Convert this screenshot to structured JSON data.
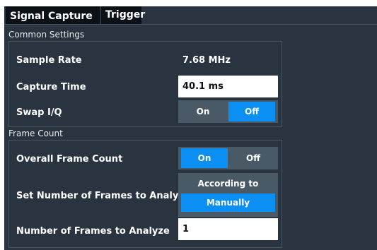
{
  "tabs": [
    {
      "label": "Signal Capture",
      "active": true
    },
    {
      "label": "Trigger",
      "active": false
    }
  ],
  "common_settings": {
    "title": "Common Settings",
    "sample_rate": {
      "label": "Sample Rate",
      "value": "7.68 MHz"
    },
    "capture_time": {
      "label": "Capture Time",
      "value": "40.1 ms"
    },
    "swap_iq": {
      "label": "Swap I/Q",
      "on": "On",
      "off": "Off",
      "selected": "Off"
    }
  },
  "frame_count": {
    "title": "Frame Count",
    "overall": {
      "label": "Overall Frame Count",
      "on": "On",
      "off": "Off",
      "selected": "On"
    },
    "set_number": {
      "label": "Set Number of Frames to Analyze",
      "option_standard": "According to Standard",
      "option_manual": "Manually",
      "selected": "Manually"
    },
    "number": {
      "label": "Number of Frames to Analyze",
      "value": "1"
    }
  },
  "colors": {
    "panel_bg": "#2a3440",
    "accent": "#0c8ff2",
    "toggle_bg": "#4a5966"
  }
}
